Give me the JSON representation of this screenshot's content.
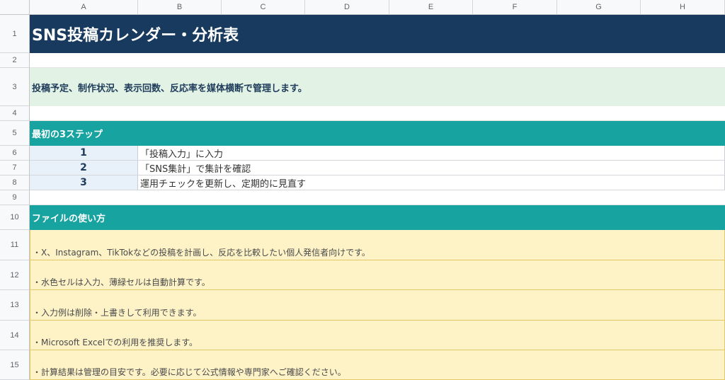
{
  "columns": [
    "A",
    "B",
    "C",
    "D",
    "E",
    "F",
    "G",
    "H"
  ],
  "rows": [
    "1",
    "2",
    "3",
    "4",
    "5",
    "6",
    "7",
    "8",
    "9",
    "10",
    "11",
    "12",
    "13",
    "14",
    "15"
  ],
  "title": "SNS投稿カレンダー・分析表",
  "description": "投稿予定、制作状況、表示回数、反応率を媒体横断で管理します。",
  "steps_header": "最初の3ステップ",
  "steps": [
    {
      "num": "1",
      "text": "「投稿入力」に入力"
    },
    {
      "num": "2",
      "text": "「SNS集計」で集計を確認"
    },
    {
      "num": "3",
      "text": "運用チェックを更新し、定期的に見直す"
    }
  ],
  "usage_header": "ファイルの使い方",
  "notes": [
    "・X、Instagram、TikTokなどの投稿を計画し、反応を比較したい個人発信者向けです。",
    "・水色セルは入力、薄緑セルは自動計算です。",
    "・入力例は削除・上書きして利用できます。",
    "・Microsoft Excelでの利用を推奨します。",
    "・計算結果は管理の目安です。必要に応じて公式情報や専門家へご確認ください。"
  ],
  "colors": {
    "title_bg": "#173a5e",
    "description_bg": "#e2f3e6",
    "section_bg": "#17a3a0",
    "step_num_bg": "#e8f0fa",
    "note_bg": "#fef3c7"
  }
}
